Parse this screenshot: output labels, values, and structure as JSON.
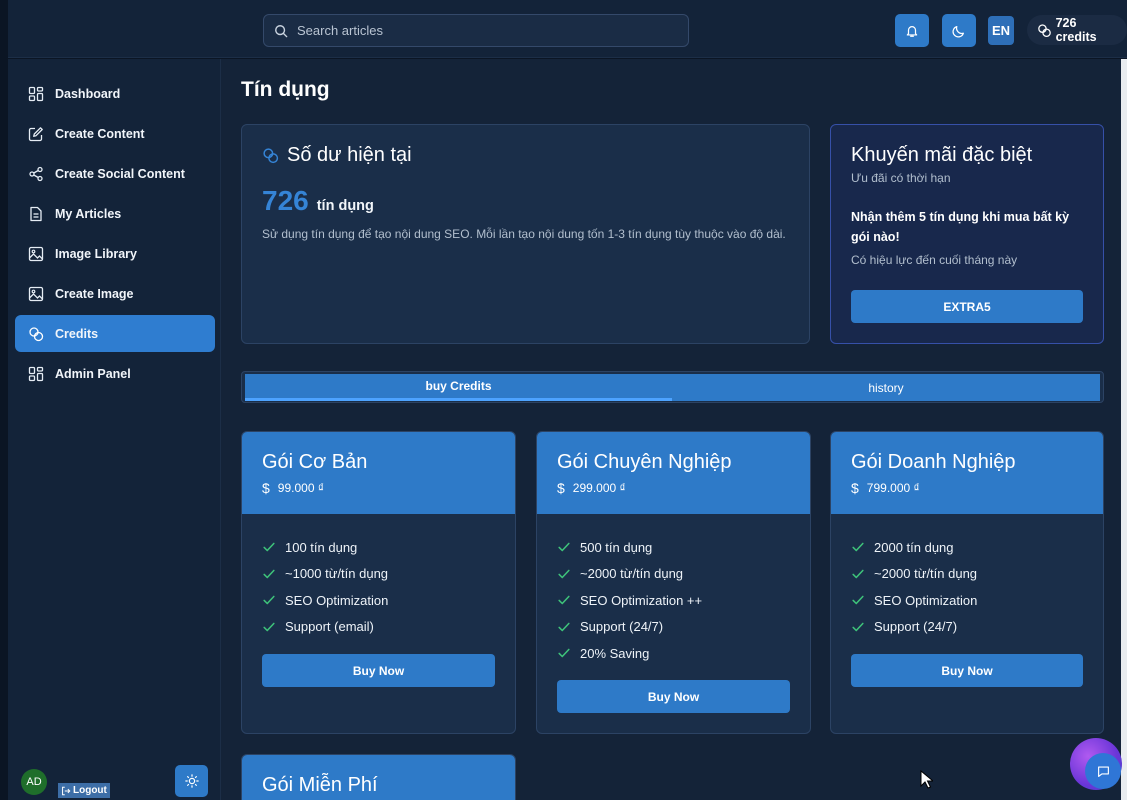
{
  "search": {
    "placeholder": "Search articles"
  },
  "header": {
    "language": "EN",
    "credits": "726 credits"
  },
  "sidebar": {
    "items": [
      {
        "label": "Dashboard",
        "icon": "dashboard-icon"
      },
      {
        "label": "Create Content",
        "icon": "edit-icon"
      },
      {
        "label": "Create Social Content",
        "icon": "share-icon"
      },
      {
        "label": "My Articles",
        "icon": "document-icon"
      },
      {
        "label": "Image Library",
        "icon": "image-icon"
      },
      {
        "label": "Create Image",
        "icon": "image-icon"
      },
      {
        "label": "Credits",
        "icon": "coins-icon",
        "active": true
      },
      {
        "label": "Admin Panel",
        "icon": "dashboard-icon"
      }
    ],
    "user_initials": "AD",
    "logout_label": "Logout"
  },
  "page": {
    "title": "Tín dụng"
  },
  "balance": {
    "title": "Số dư hiện tại",
    "amount": "726",
    "unit": "tín dụng",
    "description": "Sử dụng tín dụng để tạo nội dung SEO. Mỗi lần tạo nội dung tốn 1-3 tín dụng tùy thuộc vào độ dài."
  },
  "promo": {
    "title": "Khuyến mãi đặc biệt",
    "subtitle": "Ưu đãi có thời hạn",
    "headline": "Nhận thêm 5 tín dụng khi mua bất kỳ gói nào!",
    "validity": "Có hiệu lực đến cuối tháng này",
    "code": "EXTRA5"
  },
  "tabs": [
    {
      "label": "buy Credits",
      "active": true
    },
    {
      "label": "history",
      "active": false
    }
  ],
  "plans": [
    {
      "name": "Gói Cơ Bản",
      "currency": "$",
      "price": "99.000 ₫",
      "features": [
        "100 tín dụng",
        "~1000 từ/tín dụng",
        "SEO Optimization",
        "Support (email)"
      ],
      "button": "Buy Now"
    },
    {
      "name": "Gói Chuyên Nghiệp",
      "currency": "$",
      "price": "299.000 ₫",
      "features": [
        "500 tín dụng",
        "~2000 từ/tín dụng",
        "SEO Optimization ++",
        "Support (24/7)",
        "20% Saving"
      ],
      "button": "Buy Now"
    },
    {
      "name": "Gói Doanh Nghiệp",
      "currency": "$",
      "price": "799.000 ₫",
      "features": [
        "2000 tín dụng",
        "~2000 từ/tín dụng",
        "SEO Optimization",
        "Support (24/7)"
      ],
      "button": "Buy Now"
    },
    {
      "name": "Gói Miễn Phí"
    }
  ],
  "colors": {
    "accent": "#2e7ac8",
    "background": "#142338",
    "card": "#1a2e49",
    "check": "#3ec27a"
  }
}
